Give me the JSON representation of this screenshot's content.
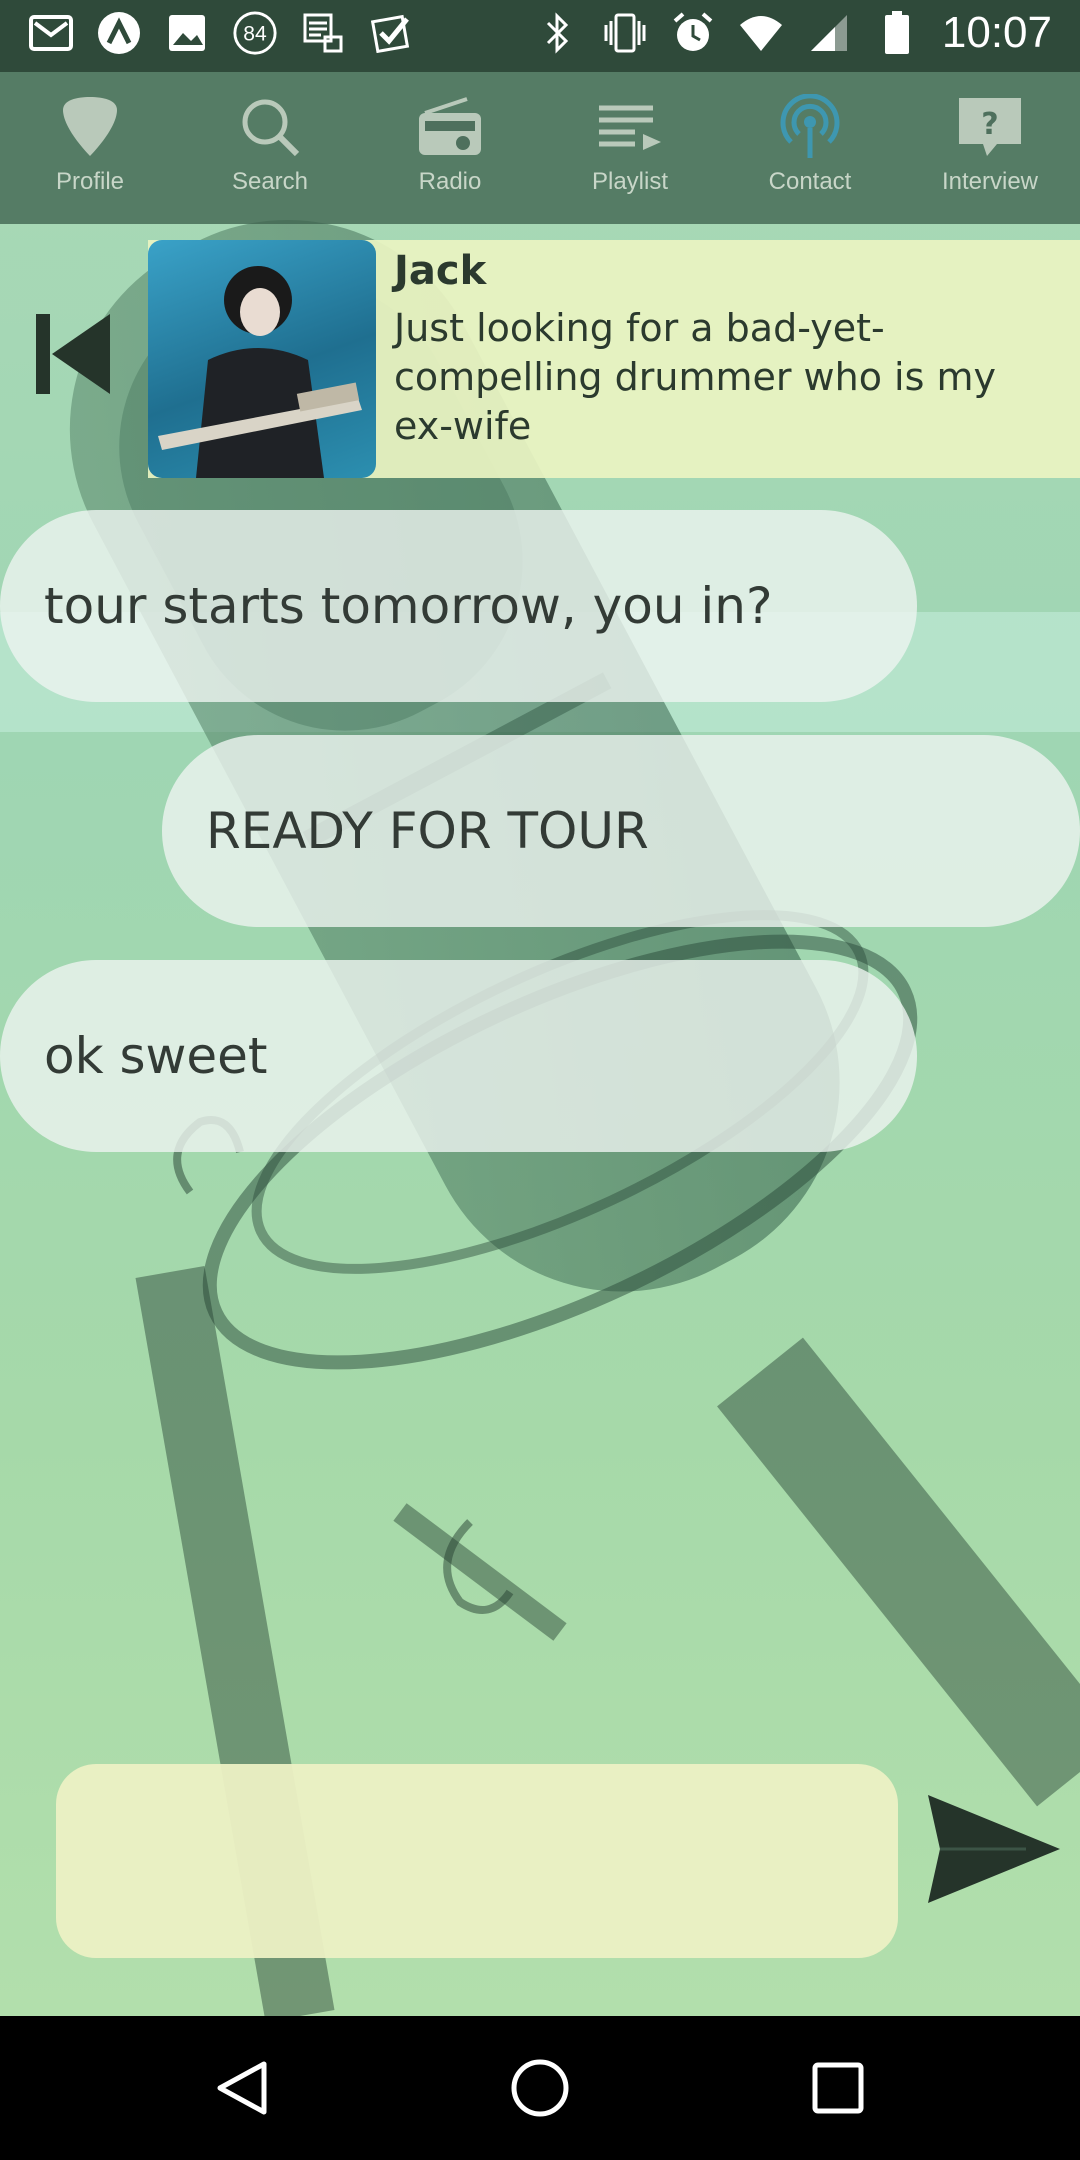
{
  "statusbar": {
    "time": "10:07",
    "badge_count": "84",
    "left_icons": [
      "gmail-icon",
      "arch-icon",
      "image-icon",
      "notification-count-icon",
      "media-icon",
      "checkmark-icon"
    ],
    "right_icons": [
      "bluetooth-icon",
      "vibrate-icon",
      "alarm-icon",
      "wifi-icon",
      "signal-icon",
      "battery-icon"
    ]
  },
  "nav": {
    "items": [
      {
        "label": "Profile",
        "icon": "guitar-pick-icon"
      },
      {
        "label": "Search",
        "icon": "search-icon"
      },
      {
        "label": "Radio",
        "icon": "radio-icon"
      },
      {
        "label": "Playlist",
        "icon": "playlist-icon"
      },
      {
        "label": "Contact",
        "icon": "broadcast-icon",
        "active": true
      },
      {
        "label": "Interview",
        "icon": "question-icon"
      }
    ],
    "active_color": "#3e97b0"
  },
  "contact": {
    "name": "Jack",
    "bio": "Just looking for a bad-yet-compelling drummer who is my ex-wife"
  },
  "messages": [
    {
      "from": "them",
      "text": "tour starts tomorrow, you in?"
    },
    {
      "from": "me",
      "text": "READY FOR TOUR"
    },
    {
      "from": "them",
      "text": "ok sweet"
    }
  ],
  "composer": {
    "value": "",
    "placeholder": ""
  },
  "colors": {
    "statusbar": "#2f4a3a",
    "nav_bg": "#3e624e",
    "card_bg": "#eaf4c2",
    "bubble_bg": "#eef4f0",
    "input_bg": "#ecf0c4",
    "icon_dark": "#25342a"
  }
}
